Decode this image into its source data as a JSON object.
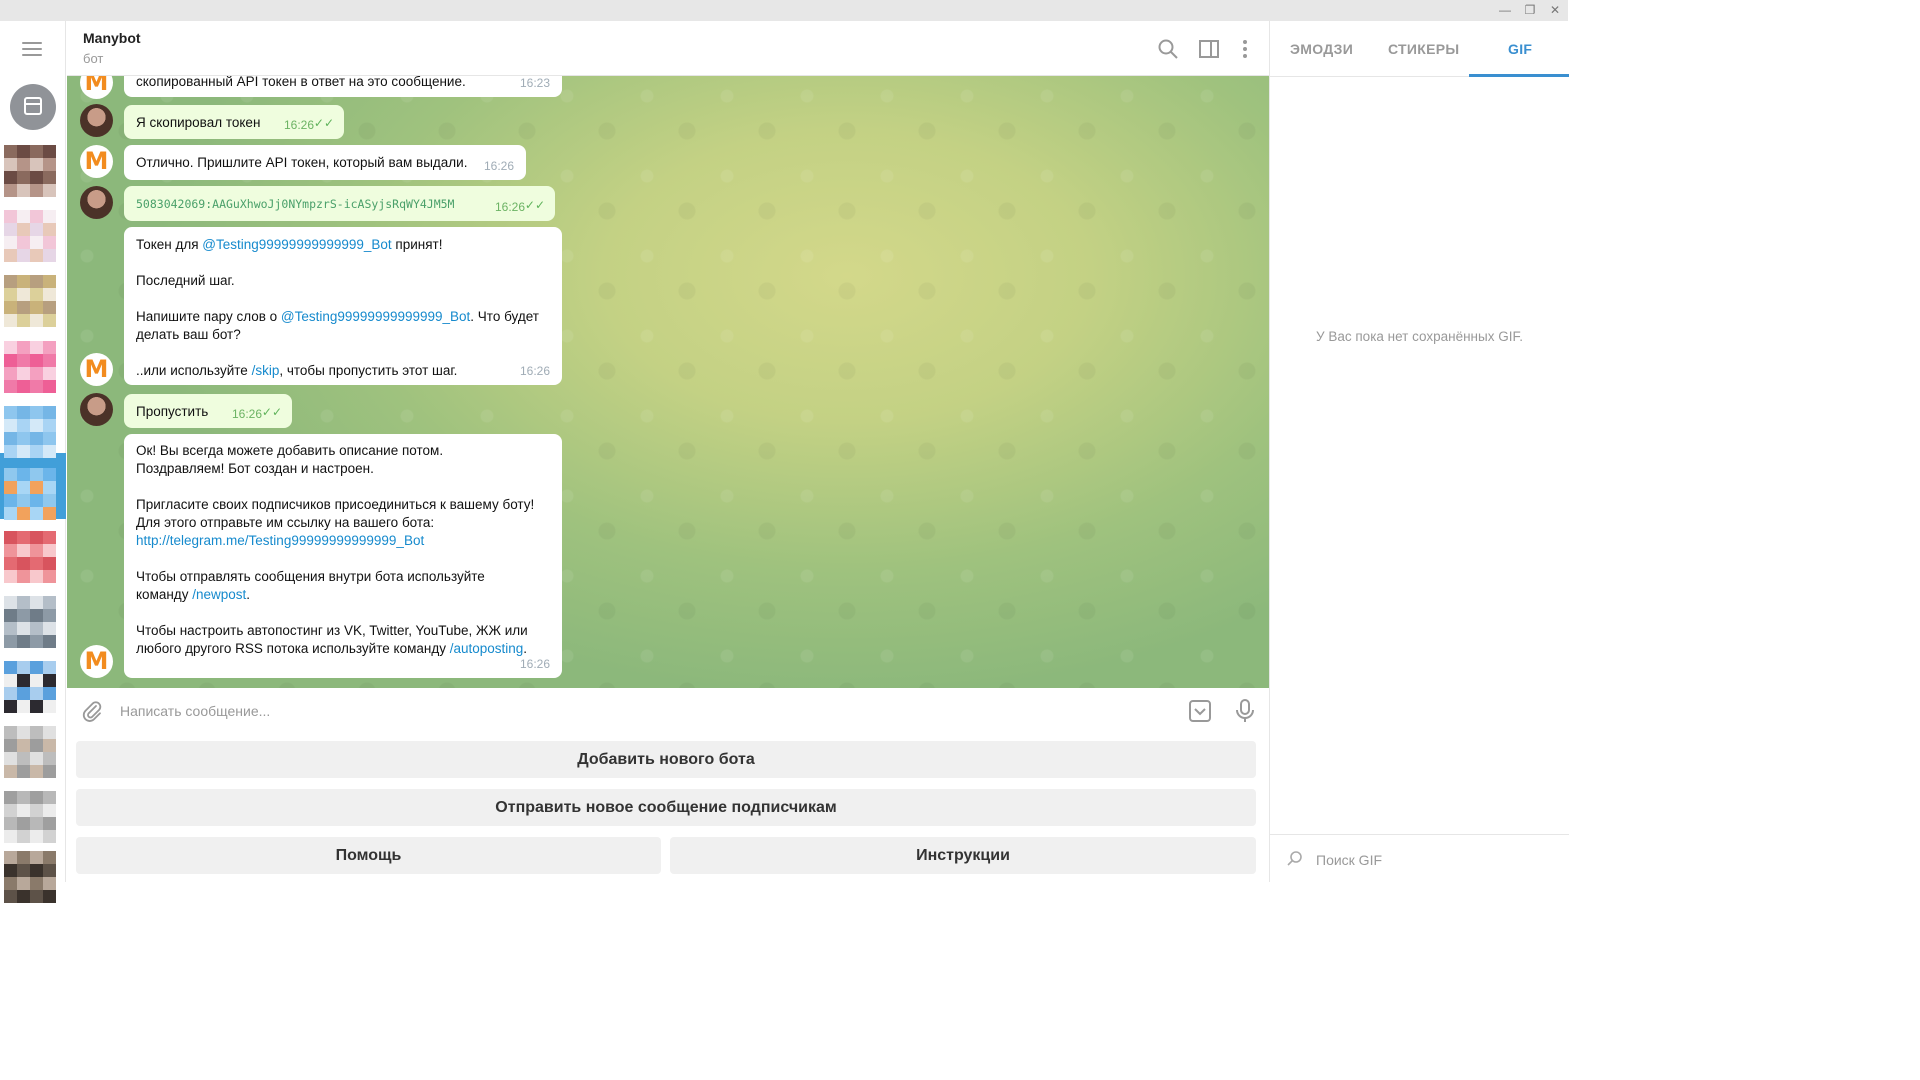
{
  "window": {
    "minimize": "—",
    "maximize": "❐",
    "close": "✕"
  },
  "chat": {
    "title": "Manybot",
    "status": "бот"
  },
  "messages": {
    "m1": {
      "text": "скопированный API токен в ответ на это сообщение.",
      "time": "16:23"
    },
    "m2": {
      "text": "Я скопировал токен",
      "time": "16:26"
    },
    "m3": {
      "text": "Отлично. Пришлите API токен, который вам выдали.",
      "time": "16:26"
    },
    "m4": {
      "text": "5083042069:AAGuXhwoJj0NYmpzrS-icASyjsRqWY4JM5M",
      "time": "16:26"
    },
    "m5": {
      "p1_pre": "Токен для ",
      "p1_link": "@Testing99999999999999_Bot",
      "p1_post": " принят!",
      "p2": "Последний шаг.",
      "p3_pre": "Напишите пару слов о ",
      "p3_link": "@Testing99999999999999_Bot",
      "p3_post": ". Что будет",
      "p3_line2": "делать ваш бот?",
      "p4_pre": "..или используйте ",
      "p4_link": "/skip",
      "p4_post": ", чтобы пропустить этот шаг.",
      "time": "16:26"
    },
    "m6": {
      "text": "Пропустить",
      "time": "16:26"
    },
    "m7": {
      "l1": "Ок! Вы всегда можете добавить описание потом.",
      "l2": "Поздравляем! Бот создан и настроен.",
      "l3": "Пригласите своих подписчиков присоединиться к вашему боту!",
      "l4": "Для этого отправьте им ссылку на вашего бота:",
      "l5_link": "http://telegram.me/Testing99999999999999_Bot",
      "l6": "Чтобы отправлять сообщения внутри бота используйте",
      "l7_pre": "команду ",
      "l7_link": "/newpost",
      "l7_post": ".",
      "l8": "Чтобы настроить автопостинг из VK, Twitter, YouTube, ЖЖ или",
      "l9_pre": "любого другого RSS потока используйте команду ",
      "l9_link": "/autoposting",
      "l9_post": ".",
      "time": "16:26"
    },
    "bot_avatar": "M"
  },
  "input": {
    "placeholder": "Написать сообщение..."
  },
  "keyboard": {
    "add_bot": "Добавить нового бота",
    "send_new": "Отправить новое сообщение подписчикам",
    "help": "Помощь",
    "instructions": "Инструкции"
  },
  "right_panel": {
    "tabs": [
      "ЭМОДЗИ",
      "СТИКЕРЫ",
      "GIF"
    ],
    "empty": "У Вас пока нет сохранённых GIF.",
    "search_placeholder": "Поиск GIF"
  },
  "colors": {
    "accent": "#3a8fd0",
    "bubble_out": "#effdde",
    "link": "#168acd",
    "bot_orange": "#f28c1f"
  }
}
